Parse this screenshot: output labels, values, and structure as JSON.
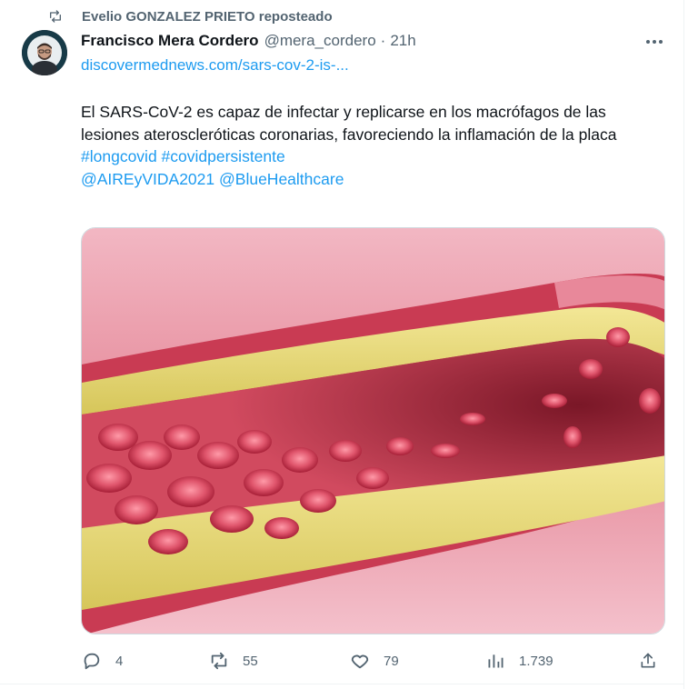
{
  "repost": {
    "text": "Evelio GONZALEZ PRIETO reposteado"
  },
  "author": {
    "name": "Francisco Mera Cordero",
    "handle": "@mera_cordero",
    "separator": "·",
    "time": "21h"
  },
  "link": {
    "text": "discovermednews.com/sars-cov-2-is-..."
  },
  "body": {
    "text": "El SARS-CoV-2 es capaz de infectar y replicarse en los macrófagos de las lesiones ateroscleróticas coronarias, favoreciendo la inflamación de la placa",
    "hashtags": [
      "#longcovid",
      "#covidpersistente"
    ],
    "mentions": [
      "@AIREyVIDA2021",
      "@BlueHealthcare"
    ]
  },
  "actions": {
    "replies": "4",
    "reposts": "55",
    "likes": "79",
    "views": "1.739"
  },
  "icons": {
    "repost": "repost-icon",
    "more": "more-icon",
    "reply": "reply-icon",
    "like": "heart-icon",
    "views": "views-icon",
    "share": "share-icon"
  },
  "colors": {
    "accent": "#1d9bf0",
    "muted": "#536471",
    "text": "#0f1419"
  }
}
